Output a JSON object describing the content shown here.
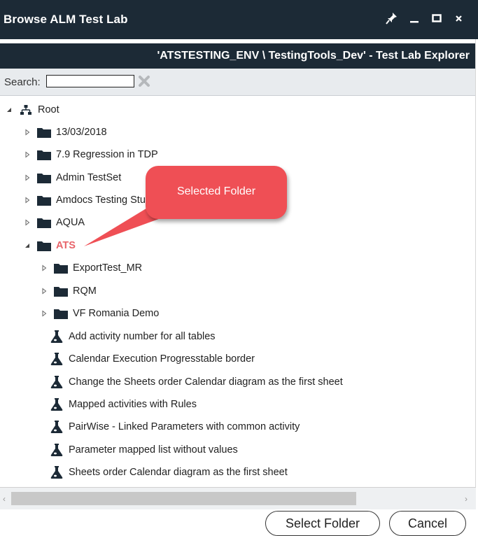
{
  "window": {
    "title": "Browse ALM Test Lab"
  },
  "subheader": {
    "text": "'ATSTESTING_ENV \\ TestingTools_Dev' - Test Lab Explorer"
  },
  "search": {
    "label": "Search:",
    "value": ""
  },
  "tree": {
    "root": "Root",
    "folders": [
      "13/03/2018",
      "7.9 Regression in TDP",
      "Admin TestSet",
      "Amdocs Testing Stu",
      "AQUA"
    ],
    "selected": "ATS",
    "subfolders": [
      "ExportTest_MR",
      "RQM",
      "VF Romania Demo"
    ],
    "testsets": [
      "Add activity number for all tables",
      "Calendar Execution Progresstable border",
      "Change the Sheets order Calendar diagram as the first sheet",
      "Mapped activities with Rules",
      "PairWise - Linked Parameters with common activity",
      "Parameter mapped list without values",
      "Sheets order Calendar diagram as the first sheet"
    ]
  },
  "callout": {
    "text": "Selected Folder"
  },
  "buttons": {
    "select": "Select Folder",
    "cancel": "Cancel"
  },
  "colors": {
    "titlebar": "#1c2a36",
    "selected_text": "#e8646a",
    "callout": "#ef4f55"
  }
}
